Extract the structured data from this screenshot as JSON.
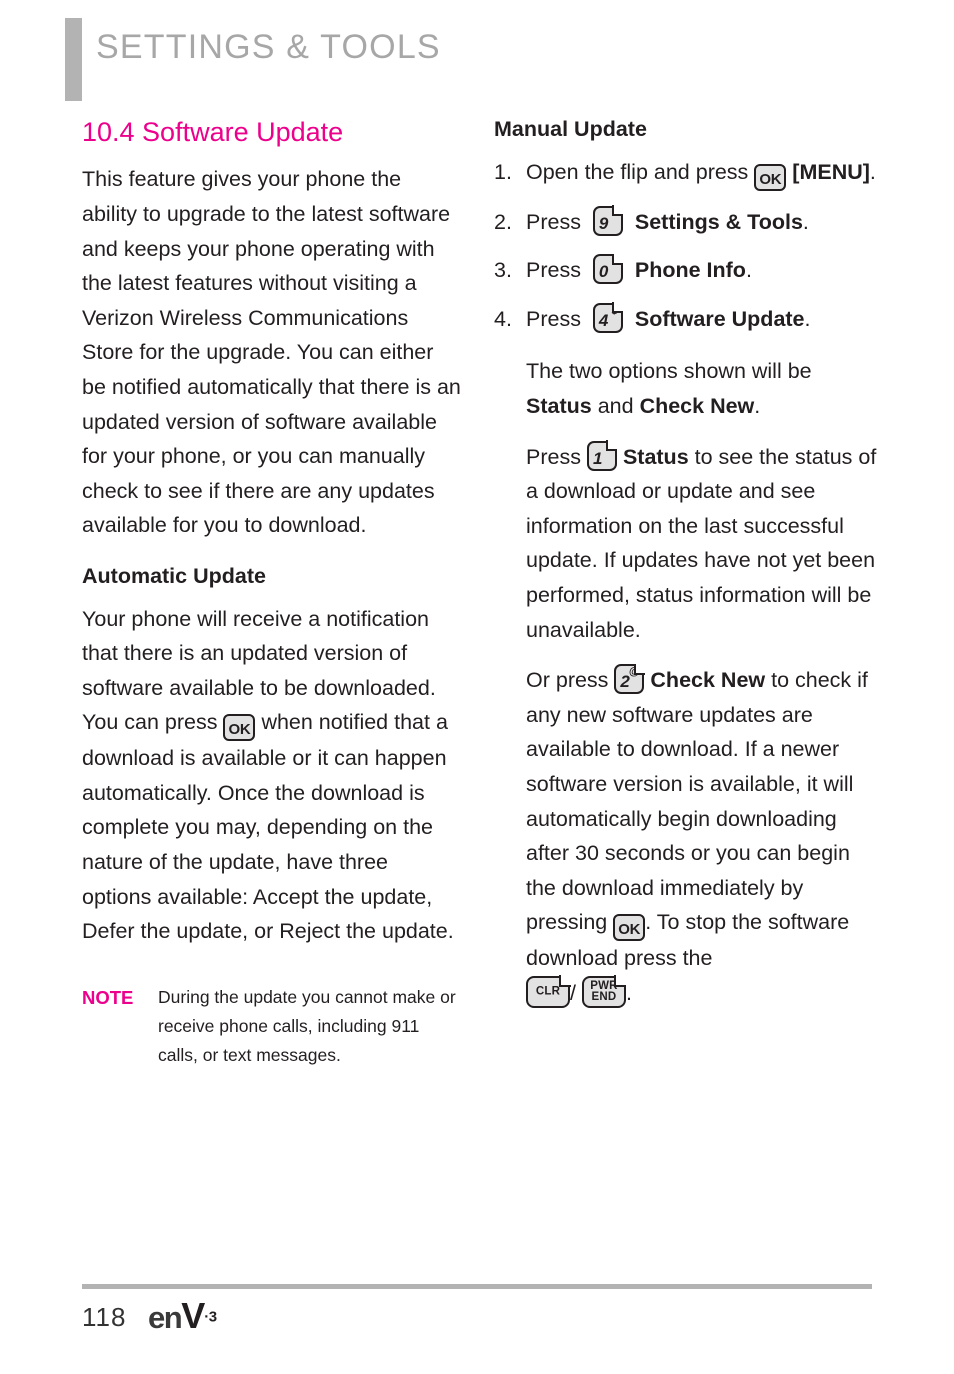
{
  "header": {
    "title": "SETTINGS & TOOLS",
    "bar_color": "#b3b3b3",
    "title_color": "#a7a7a7"
  },
  "accent_color": "#ec008c",
  "left_column": {
    "section_title": "10.4 Software Update",
    "intro_paragraph": "This feature gives your phone the ability to upgrade to the latest software and keeps your phone operating with the latest features without visiting a Verizon Wireless Communications Store for the upgrade. You can either be notified automatically that there is an updated version of software available for your phone, or you can manually check to see if there are any updates available for you to download.",
    "automatic_update_heading": "Automatic Update",
    "automatic_update_part1": "Your phone will receive a notification that there is an updated version of software available to be downloaded. You can press",
    "automatic_update_part2": "when notified that a download is available or it can happen automatically. Once the download is complete you may, depending on the nature of the update, have three options available: Accept the update, Defer the update, or Reject the update.",
    "ok_key_label": "OK",
    "note": {
      "label": "NOTE",
      "text": "During the update you cannot make or receive phone calls, including 911 calls, or text messages."
    }
  },
  "right_column": {
    "manual_update_heading": "Manual Update",
    "steps": [
      {
        "number": "1.",
        "text_before": "Open the flip and press",
        "key": {
          "type": "ok",
          "label": "OK"
        },
        "text_after_bold": "[MENU]",
        "text_after": "."
      },
      {
        "number": "2.",
        "text_before": "Press",
        "key": {
          "type": "numeric",
          "digit": "9",
          "superscript": "‘"
        },
        "text_after_bold": "Settings & Tools",
        "text_after": "."
      },
      {
        "number": "3.",
        "text_before": "Press",
        "key": {
          "type": "numeric",
          "digit": "0",
          "superscript": "’"
        },
        "text_after_bold": "Phone Info",
        "text_after": "."
      },
      {
        "number": "4.",
        "text_before": "Press",
        "key": {
          "type": "numeric",
          "digit": "4",
          "superscript": "$"
        },
        "text_after_bold": "Software Update",
        "text_after": "."
      }
    ],
    "options_intro_part1": "The two options shown will be",
    "options_bold_1": "Status",
    "options_and": "and",
    "options_bold_2": "Check New",
    "options_period": ".",
    "status_para_before": "Press",
    "status_key": {
      "type": "numeric",
      "digit": "1",
      "superscript": "’"
    },
    "status_bold": "Status",
    "status_para_after": "to see the status of a download or update and see information on the last successful update. If updates have not yet been performed, status information will be unavailable.",
    "check_para_before": "Or press",
    "check_key": {
      "type": "numeric",
      "digit": "2",
      "superscript": "@"
    },
    "check_bold": "Check New",
    "check_para_mid": "to check if any new software updates are available to download. If a newer software version is available, it will automatically begin downloading after 30 seconds or you can begin the download immediately by pressing",
    "ok_key_label": "OK",
    "check_para_after": ". To stop the software download press the",
    "clr_key": {
      "label": "CLR"
    },
    "separator": "/",
    "pwr_key": {
      "line1": "PWR",
      "line2": "END"
    },
    "final_period": "."
  },
  "footer": {
    "page_number": "118",
    "logo_en": "en",
    "logo_v": "V",
    "logo_superscript": "·3"
  }
}
